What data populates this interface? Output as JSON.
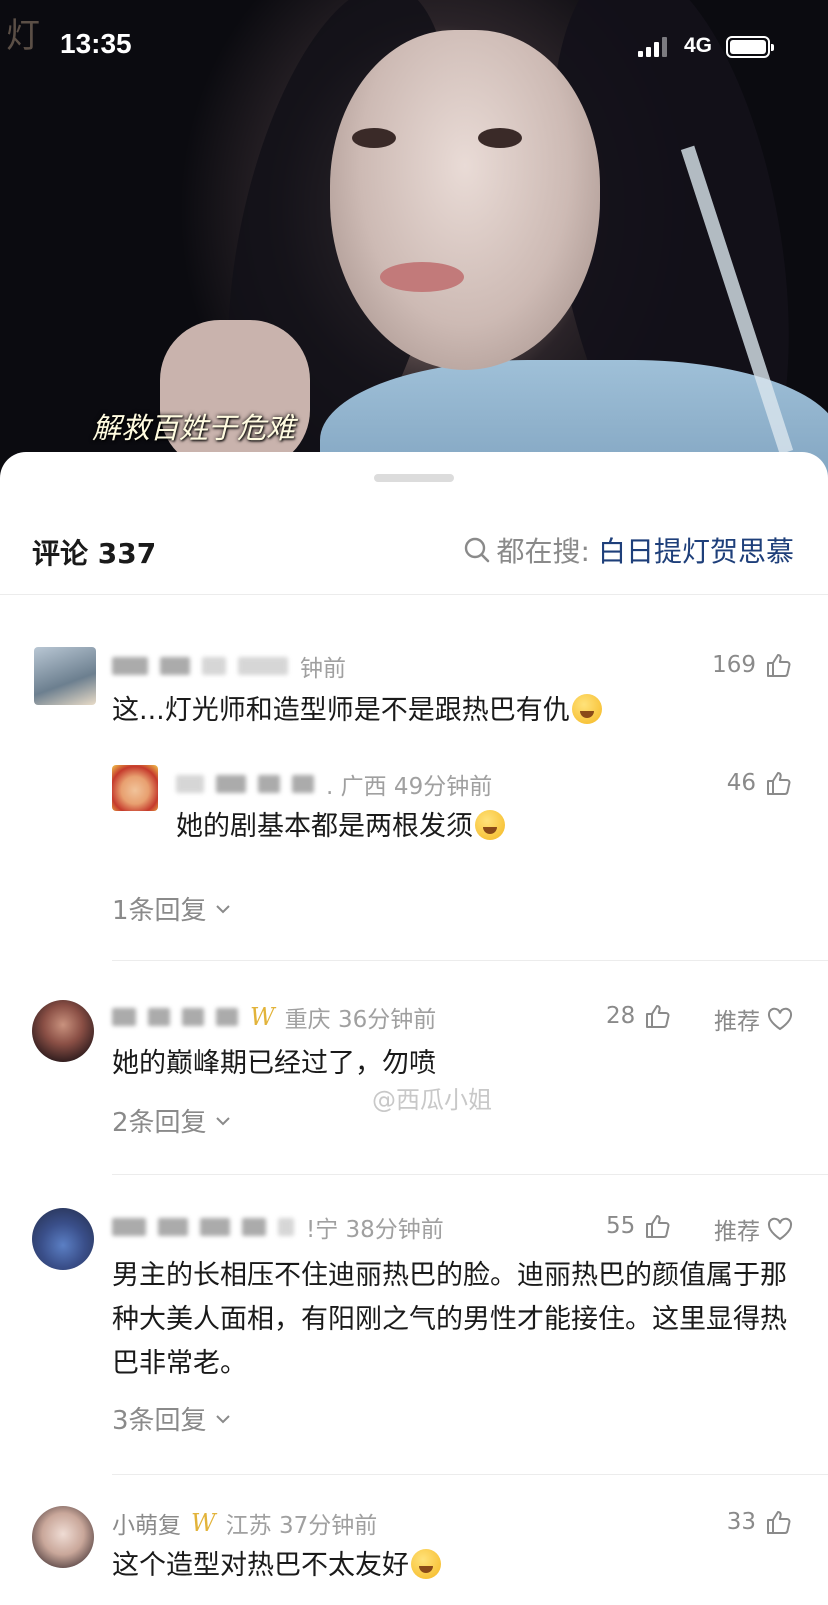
{
  "status_bar": {
    "time": "13:35",
    "network": "4G"
  },
  "video": {
    "subtitle": "解救百姓于危难",
    "corner_text": "灯"
  },
  "comments_panel": {
    "count_label": "评论 337",
    "search_prefix": "都在搜:",
    "search_keyword": "白日提灯贺思慕"
  },
  "comments": [
    {
      "meta_suffix": "钟前",
      "likes": "169",
      "text": "这...灯光师和造型师是不是跟热巴有仇",
      "emoji": "laugh-cry-emoji"
    },
    {
      "reply": true,
      "meta_suffix": ". 广西 49分钟前",
      "likes": "46",
      "text": "她的剧基本都是两根发须",
      "emoji": "laugh-cry-emoji",
      "replies_label": "1条回复"
    },
    {
      "meta_suffix": "重庆 36分钟前",
      "likes": "28",
      "recommend": "推荐",
      "text": "她的巅峰期已经过了，勿喷",
      "replies_label": "2条回复"
    },
    {
      "meta_suffix": "!宁 38分钟前",
      "likes": "55",
      "recommend": "推荐",
      "text": "男主的长相压不住迪丽热巴的脸。迪丽热巴的颜值属于那种大美人面相，有阳刚之气的男性才能接住。这里显得热巴非常老。",
      "replies_label": "3条回复"
    },
    {
      "meta_prefix": "小萌复",
      "meta_suffix": "江苏 37分钟前",
      "likes": "33",
      "text": "这个造型对热巴不太友好",
      "emoji": "surprised-emoji"
    }
  ],
  "watermark": "@西瓜小姐",
  "colors": {
    "keyword": "#1e3f7a",
    "muted": "#8a8a8a",
    "badge_gold": "#e2b33a"
  }
}
